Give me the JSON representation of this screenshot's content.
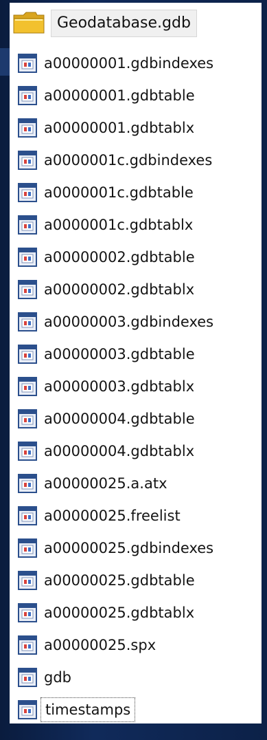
{
  "header": {
    "folder_label": "Geodatabase.gdb",
    "icon": "folder-icon"
  },
  "files": [
    {
      "name": "a00000001.gdbindexes",
      "icon": "file-icon"
    },
    {
      "name": "a00000001.gdbtable",
      "icon": "file-icon"
    },
    {
      "name": "a00000001.gdbtablx",
      "icon": "file-icon"
    },
    {
      "name": "a0000001c.gdbindexes",
      "icon": "file-icon"
    },
    {
      "name": "a0000001c.gdbtable",
      "icon": "file-icon"
    },
    {
      "name": "a0000001c.gdbtablx",
      "icon": "file-icon"
    },
    {
      "name": "a00000002.gdbtable",
      "icon": "file-icon"
    },
    {
      "name": "a00000002.gdbtablx",
      "icon": "file-icon"
    },
    {
      "name": "a00000003.gdbindexes",
      "icon": "file-icon"
    },
    {
      "name": "a00000003.gdbtable",
      "icon": "file-icon"
    },
    {
      "name": "a00000003.gdbtablx",
      "icon": "file-icon"
    },
    {
      "name": "a00000004.gdbtable",
      "icon": "file-icon"
    },
    {
      "name": "a00000004.gdbtablx",
      "icon": "file-icon"
    },
    {
      "name": "a00000025.a.atx",
      "icon": "file-icon"
    },
    {
      "name": "a00000025.freelist",
      "icon": "file-icon"
    },
    {
      "name": "a00000025.gdbindexes",
      "icon": "file-icon"
    },
    {
      "name": "a00000025.gdbtable",
      "icon": "file-icon"
    },
    {
      "name": "a00000025.gdbtablx",
      "icon": "file-icon"
    },
    {
      "name": "a00000025.spx",
      "icon": "file-icon"
    },
    {
      "name": "gdb",
      "icon": "file-icon"
    },
    {
      "name": "timestamps",
      "icon": "file-icon",
      "focused": true
    }
  ],
  "colors": {
    "background": "#0f2754",
    "folder": "#f2c12e",
    "folder_dark": "#d9a51f",
    "file_icon_frame": "#2b4f8c",
    "file_icon_fill": "#e9eef7",
    "file_icon_mark": "#d9423c"
  }
}
